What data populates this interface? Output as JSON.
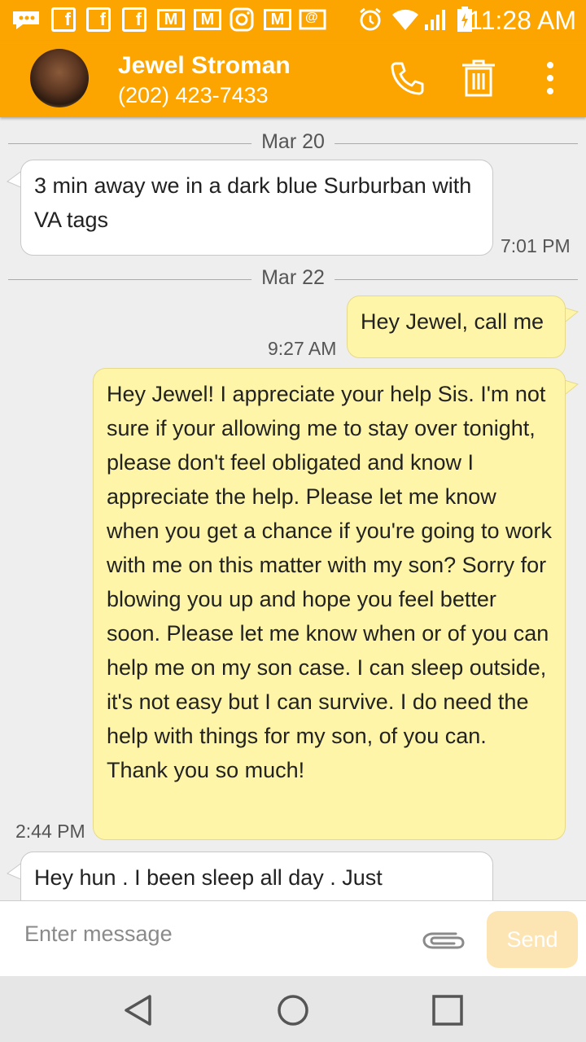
{
  "status_bar": {
    "time": "11:28 AM",
    "icons": [
      "more-notifications-icon",
      "facebook-icon",
      "facebook-icon",
      "facebook-icon",
      "gmail-icon",
      "gmail-icon",
      "instagram-icon",
      "gmail-icon",
      "email-icon",
      "alarm-icon",
      "wifi-icon",
      "signal-icon",
      "battery-icon"
    ],
    "fb_letter": "f",
    "mail_letter": "M",
    "at_sign": "@"
  },
  "header": {
    "contact_name": "Jewel Stroman",
    "contact_phone": "(202) 423-7433",
    "actions": [
      "call",
      "delete",
      "more-options"
    ]
  },
  "conversation": {
    "date_1": "Mar 20",
    "msg_1": {
      "direction": "incoming",
      "text": "3 min away we in a dark blue Surburban with VA tags",
      "time": "7:01 PM"
    },
    "date_2": "Mar 22",
    "msg_2": {
      "direction": "outgoing",
      "text": "Hey Jewel, call me",
      "time": "9:27 AM"
    },
    "msg_3": {
      "direction": "outgoing",
      "text": "Hey Jewel! I appreciate your help Sis. I'm not sure if your allowing me to stay over tonight, please don't feel obligated and know I appreciate the help. Please let me know when you get a chance if you're going to work with me on this matter with my son? Sorry for blowing you up and hope you feel better soon. Please let me know when or of you can help me on my son case. I can sleep outside, it's not easy but I can survive. I do need the help with things for my son, of you can. Thank you so much!",
      "time": "2:44 PM"
    },
    "msg_4": {
      "direction": "incoming",
      "text": "Hey hun . I been sleep all day . Just"
    }
  },
  "composer": {
    "placeholder": "Enter message",
    "send_label": "Send"
  },
  "nav": [
    "back",
    "home",
    "recents"
  ],
  "colors": {
    "accent": "#fca500",
    "incoming_bubble": "#ffffff",
    "outgoing_bubble": "#fff5a8",
    "send_disabled": "#fde4b3"
  }
}
